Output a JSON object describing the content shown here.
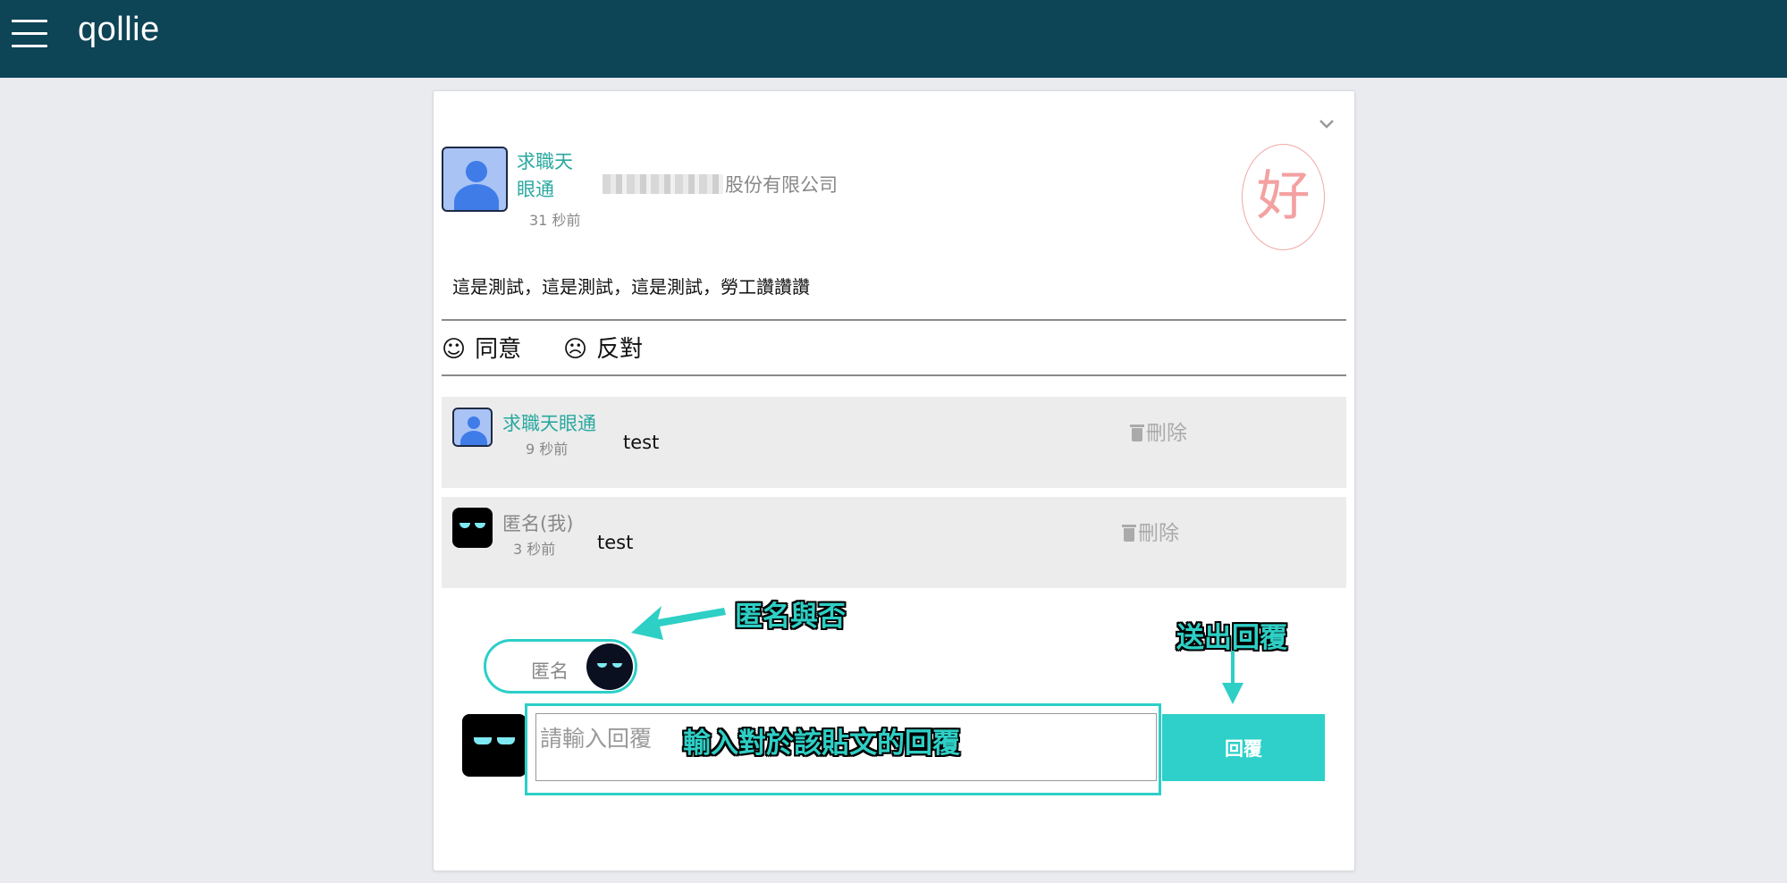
{
  "app": {
    "logo": "qollie"
  },
  "post": {
    "poster_name": "求職天眼通",
    "time": "31 秒前",
    "company_suffix": "股份有限公司",
    "rating": "好",
    "body": "這是測試，這是測試，這是測試，勞工讚讚讚"
  },
  "reactions": {
    "agree": "同意",
    "disagree": "反對"
  },
  "replies": [
    {
      "name": "求職天眼通",
      "time": "9 秒前",
      "text": "test",
      "delete_label": "刪除"
    },
    {
      "name": "匿名(我)",
      "time": "3 秒前",
      "text": "test",
      "delete_label": "刪除"
    }
  ],
  "composer": {
    "anonymous_toggle_label": "匿名",
    "placeholder": "請輸入回覆",
    "submit_label": "回覆"
  },
  "annotations": {
    "anonymous": "匿名與否",
    "submit": "送出回覆",
    "input": "輸入對於該貼文的回覆"
  },
  "colors": {
    "topbar": "#0d4456",
    "accent": "#2ed0c9",
    "poster_name": "#2aa8a0",
    "rating": "#f4a1a1"
  }
}
